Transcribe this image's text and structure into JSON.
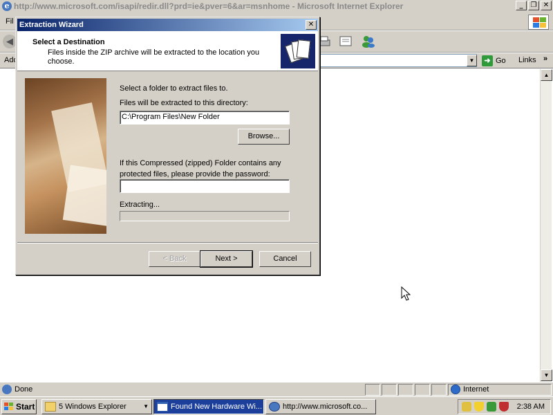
{
  "ie_window": {
    "title": "http://www.microsoft.com/isapi/redir.dll?prd=ie&pver=6&ar=msnhome - Microsoft Internet Explorer",
    "menu_file_partial": "Fil",
    "address_label_partial": "Add",
    "go_label": "Go",
    "links_label": "Links",
    "status_text": "Done",
    "zone_text": "Internet"
  },
  "dialog": {
    "title": "Extraction Wizard",
    "header_title": "Select a Destination",
    "header_subtitle": "Files inside the ZIP archive will be extracted to the location you choose.",
    "intro_text": "Select a folder to extract files to.",
    "dir_label": "Files will be extracted to this directory:",
    "dir_value": "C:\\Program Files\\New Folder",
    "browse_label": "Browse...",
    "password_text": "If this Compressed (zipped) Folder contains any protected files, please provide the password:",
    "password_value": "",
    "extracting_label": "Extracting...",
    "progress": 0,
    "back_label": "< Back",
    "next_label": "Next >",
    "cancel_label": "Cancel"
  },
  "taskbar": {
    "start_label": "Start",
    "tasks": [
      {
        "label": "5 Windows Explorer",
        "icon": "folder-icon",
        "active": false
      },
      {
        "label": "Found New Hardware Wi...",
        "icon": "window-icon",
        "active": true
      },
      {
        "label": "http://www.microsoft.co...",
        "icon": "ie-icon",
        "active": false
      }
    ],
    "clock": "2:38 AM"
  },
  "colors": {
    "title_active": "#0a246a",
    "face": "#d4d0c8",
    "task_active": "#1c3f9c"
  }
}
